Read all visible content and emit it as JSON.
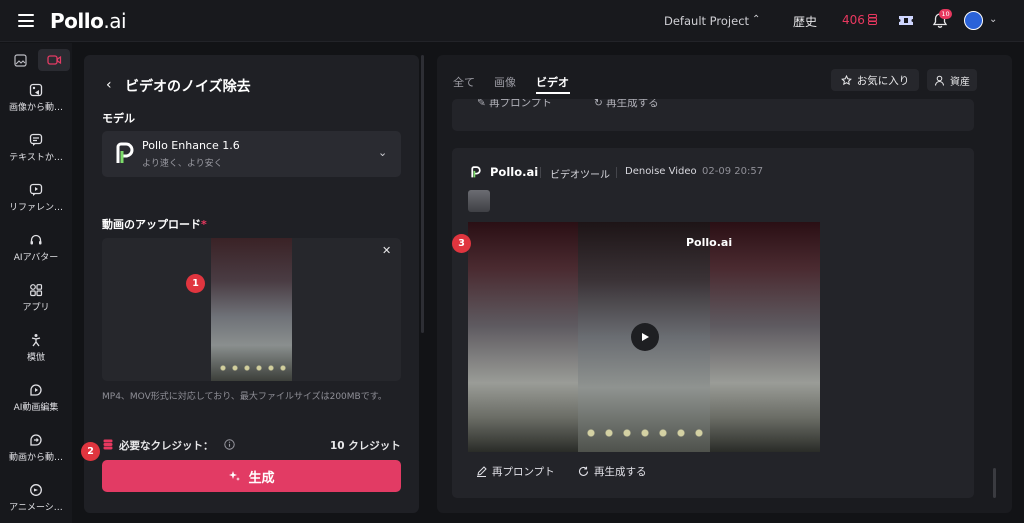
{
  "header": {
    "logo_main": "Pollo",
    "logo_suffix": ".ai",
    "project_name": "Default Project",
    "history_label": "歴史",
    "credits_value": "406",
    "notification_count": "10"
  },
  "sidebar": {
    "items": [
      {
        "label": "画像から動…"
      },
      {
        "label": "テキストか…"
      },
      {
        "label": "リファレン…"
      },
      {
        "label": "AIアバター"
      },
      {
        "label": "アプリ"
      },
      {
        "label": "模倣"
      },
      {
        "label": "AI動画編集"
      },
      {
        "label": "動画から動…"
      },
      {
        "label": "アニメーシ…"
      }
    ]
  },
  "left_panel": {
    "title": "ビデオのノイズ除去",
    "model_label": "モデル",
    "model_name": "Pollo Enhance 1.6",
    "model_subtitle": "より速く、より安く",
    "upload_label": "動画のアップロード",
    "required_mark": "*",
    "upload_note": "MP4、MOV形式に対応しており、最大ファイルサイズは200MBです。",
    "credits_label": "必要なクレジット：",
    "credits_value": "10 クレジット",
    "generate_label": "生成"
  },
  "right_panel": {
    "tabs": [
      {
        "label": "全て"
      },
      {
        "label": "画像"
      },
      {
        "label": "ビデオ"
      }
    ],
    "favorites_label": "お気に入り",
    "assets_label": "資産",
    "prev_card": {
      "reprompt_label": "再プロンプト",
      "regenerate_label": "再生成する"
    },
    "card": {
      "brand": "Pollo.ai",
      "tool": "ビデオツール",
      "name": "Denoise Video",
      "date": "02-09 20:57",
      "watermark": "Pollo.ai",
      "reprompt_label": "再プロンプト",
      "regenerate_label": "再生成する"
    }
  },
  "markers": [
    "1",
    "2",
    "3"
  ],
  "colors": {
    "accent": "#e23b64",
    "credits": "#e8385f",
    "marker": "#e0353f"
  }
}
